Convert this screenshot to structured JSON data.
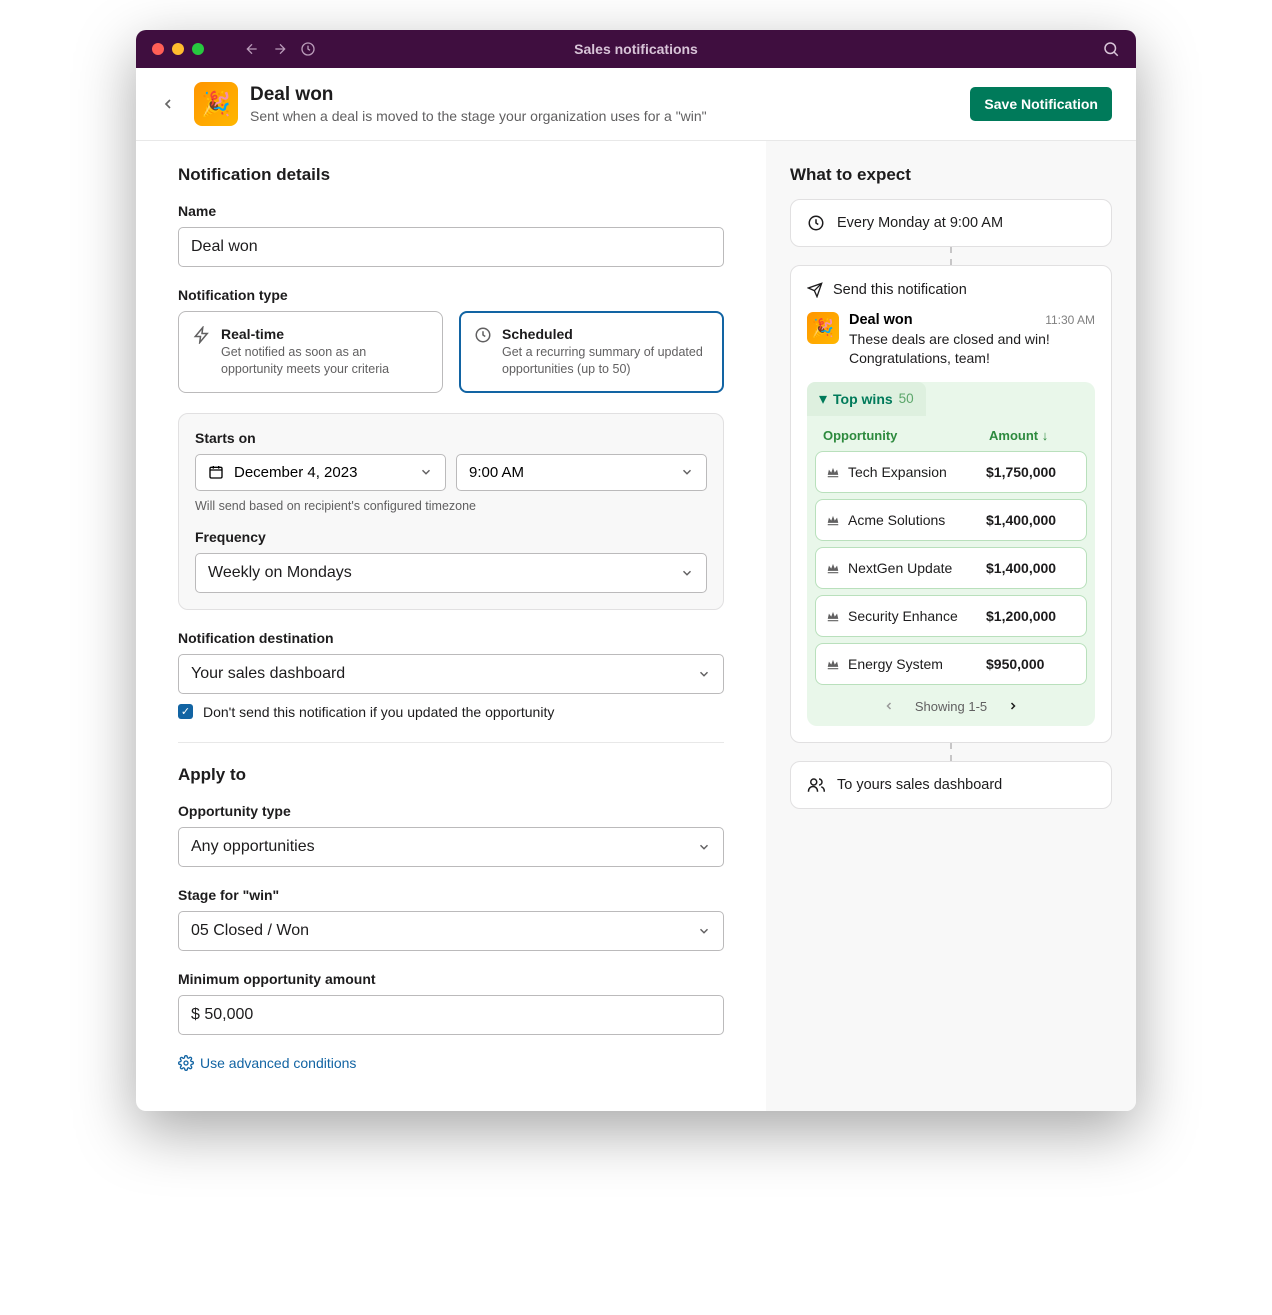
{
  "titlebar": {
    "title": "Sales notifications"
  },
  "header": {
    "title": "Deal won",
    "subtitle": "Sent when a deal is moved to the stage your organization uses for a \"win\"",
    "save_button": "Save Notification"
  },
  "details": {
    "section_title": "Notification details",
    "name_label": "Name",
    "name_value": "Deal won",
    "type_label": "Notification type",
    "realtime": {
      "title": "Real-time",
      "desc": "Get notified as soon as an opportunity meets your criteria"
    },
    "scheduled": {
      "title": "Scheduled",
      "desc": "Get a recurring summary of updated opportunities (up to 50)"
    },
    "starts_on_label": "Starts on",
    "date_value": "December 4, 2023",
    "time_value": "9:00 AM",
    "timezone_hint": "Will send based on recipient's configured timezone",
    "frequency_label": "Frequency",
    "frequency_value": "Weekly on Mondays",
    "destination_label": "Notification destination",
    "destination_value": "Your sales dashboard",
    "suppress_checkbox": "Don't send this notification if you updated the opportunity"
  },
  "apply": {
    "section_title": "Apply to",
    "opp_type_label": "Opportunity type",
    "opp_type_value": "Any opportunities",
    "stage_label": "Stage for \"win\"",
    "stage_value": "05 Closed / Won",
    "min_amount_label": "Minimum opportunity amount",
    "min_amount_value": "$ 50,000",
    "advanced_link": "Use advanced conditions"
  },
  "expect": {
    "section_title": "What to expect",
    "schedule_summary": "Every Monday at 9:00 AM",
    "send_label": "Send this notification",
    "preview": {
      "title": "Deal won",
      "time": "11:30 AM",
      "text": "These deals are closed and win! Congratulations, team!",
      "wins_title": "Top wins",
      "wins_count": "50",
      "col_opportunity": "Opportunity",
      "col_amount": "Amount ↓",
      "rows": [
        {
          "name": "Tech Expansion",
          "amount": "$1,750,000"
        },
        {
          "name": "Acme Solutions",
          "amount": "$1,400,000"
        },
        {
          "name": "NextGen Update",
          "amount": "$1,400,000"
        },
        {
          "name": "Security Enhance",
          "amount": "$1,200,000"
        },
        {
          "name": "Energy System",
          "amount": "$950,000"
        }
      ],
      "pager": "Showing 1-5"
    },
    "destination_summary": "To yours sales dashboard"
  }
}
